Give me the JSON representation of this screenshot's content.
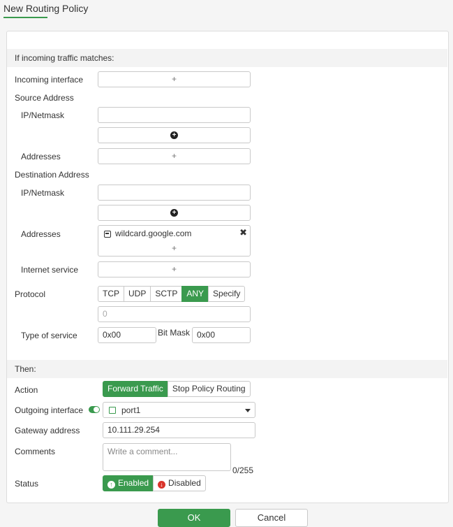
{
  "page": {
    "title": "New Routing Policy"
  },
  "match_section": {
    "header": "If incoming traffic matches:",
    "incoming_interface_label": "Incoming interface",
    "source_address_label": "Source Address",
    "source_ip_label": "IP/Netmask",
    "source_addresses_label": "Addresses",
    "destination_address_label": "Destination Address",
    "dest_ip_label": "IP/Netmask",
    "dest_addresses_label": "Addresses",
    "dest_address_chip": "wildcard.google.com",
    "internet_service_label": "Internet service",
    "protocol_label": "Protocol",
    "protocol_options": [
      "TCP",
      "UDP",
      "SCTP",
      "ANY",
      "Specify"
    ],
    "protocol_selected": "ANY",
    "protocol_number": "0",
    "tos_label": "Type of service",
    "tos_value": "0x00",
    "bitmask_label": "Bit Mask",
    "bitmask_value": "0x00",
    "add_symbol": "+",
    "remove_symbol": "✖"
  },
  "then_section": {
    "header": "Then:",
    "action_label": "Action",
    "action_options": [
      "Forward Traffic",
      "Stop Policy Routing"
    ],
    "action_selected": "Forward Traffic",
    "outgoing_interface_label": "Outgoing interface",
    "outgoing_interface_value": "port1",
    "gateway_label": "Gateway address",
    "gateway_value": "10.111.29.254",
    "comments_label": "Comments",
    "comments_placeholder": "Write a comment...",
    "comments_counter": "0/255",
    "status_label": "Status",
    "status_options": [
      "Enabled",
      "Disabled"
    ],
    "status_selected": "Enabled"
  },
  "footer": {
    "ok_label": "OK",
    "cancel_label": "Cancel"
  },
  "colors": {
    "accent": "#3a9a4e",
    "danger": "#d9342b"
  }
}
